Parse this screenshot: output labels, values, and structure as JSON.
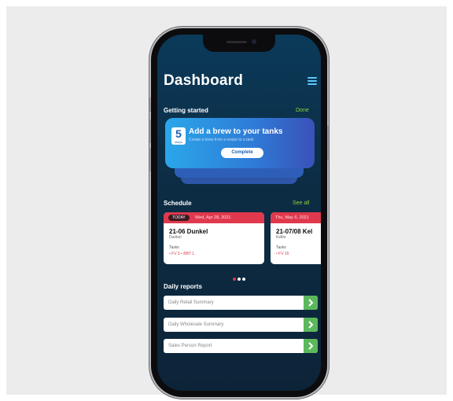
{
  "header": {
    "title": "Dashboard",
    "menu_icon": "hamburger-menu-icon"
  },
  "getting_started": {
    "title": "Getting started",
    "link": "Done",
    "task": {
      "count": "5",
      "count_unit": "steps",
      "title": "Add a brew to your tanks",
      "subtitle": "Create a brew from a recipe to a tank",
      "button": "Complete"
    }
  },
  "schedule": {
    "title": "Schedule",
    "link": "See all",
    "cards": [
      {
        "badge": "TODAY",
        "date": "Wed, Apr 28, 2021",
        "name": "21-06 Dunkel",
        "type": "Dunkel",
        "tasks_label": "Tasks",
        "tasks": "• FV 3   • BBT 1"
      },
      {
        "badge": "",
        "date": "Thu, May 6, 2021",
        "name": "21-07/08 Kel",
        "type": "Keller",
        "tasks_label": "Tasks",
        "tasks": "• FV 16"
      }
    ],
    "pager": {
      "count": 3,
      "active": 0
    }
  },
  "daily_reports": {
    "title": "Daily reports",
    "items": [
      {
        "label": "Daily Retail Summary"
      },
      {
        "label": "Daily Wholesale Summary"
      },
      {
        "label": "Sales Person Report"
      }
    ]
  },
  "colors": {
    "accent_red": "#e0394e",
    "accent_green": "#8bd43a",
    "arrow_green": "#5cb85c",
    "bg_dark": "#0c2d45",
    "card_blue": "#2f7ad6"
  }
}
